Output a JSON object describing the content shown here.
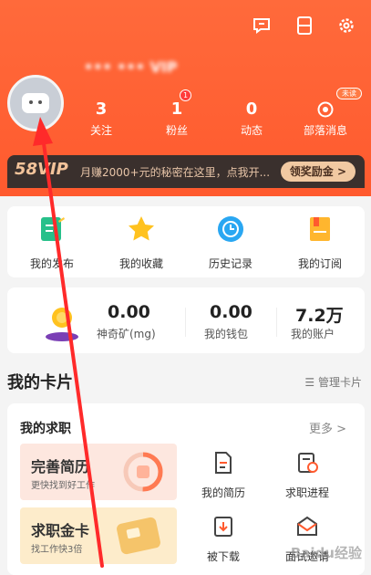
{
  "header": {
    "username": "••• ••• VIP",
    "icons": [
      "chat-icon",
      "scan-card-icon",
      "gear-icon"
    ],
    "stats": [
      {
        "value": "3",
        "label": "关注"
      },
      {
        "value": "1",
        "label": "粉丝",
        "badge": "1"
      },
      {
        "value": "0",
        "label": "动态"
      },
      {
        "value": "",
        "label": "部落消息",
        "badge": "未读"
      }
    ]
  },
  "vip": {
    "logo": "58VIP",
    "text": "月赚2000+元的秘密在这里，点我开...",
    "button": "领奖励金 >"
  },
  "quick_actions": [
    {
      "label": "我的发布",
      "icon": "edit-icon"
    },
    {
      "label": "我的收藏",
      "icon": "star-icon"
    },
    {
      "label": "历史记录",
      "icon": "clock-icon"
    },
    {
      "label": "我的订阅",
      "icon": "subscribe-icon"
    }
  ],
  "wallet": [
    {
      "value": "0.00",
      "label": "神奇矿(mg)"
    },
    {
      "value": "0.00",
      "label": "我的钱包"
    },
    {
      "value": "7.2万",
      "label": "我的账户"
    }
  ],
  "cards_section": {
    "title": "我的卡片",
    "manage": "管理卡片"
  },
  "job": {
    "title": "我的求职",
    "more": "更多 >",
    "promos": [
      {
        "title": "完善简历",
        "subtitle": "更快找到好工作"
      },
      {
        "title": "求职金卡",
        "subtitle": "找工作快3倍"
      }
    ],
    "items": [
      {
        "label": "我的简历",
        "icon": "resume-icon"
      },
      {
        "label": "求职进程",
        "icon": "progress-icon"
      },
      {
        "label": "被下载",
        "icon": "download-icon"
      },
      {
        "label": "面试邀请",
        "icon": "invite-icon"
      }
    ]
  },
  "watermark": "Baidu经验",
  "colors": {
    "brand": "#ff5a2e",
    "annotation": "#ff2a2a",
    "vip_gold": "#f1c9a2"
  }
}
